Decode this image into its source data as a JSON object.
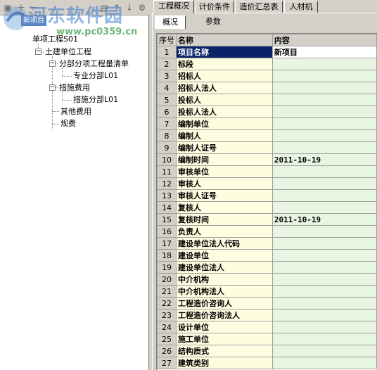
{
  "watermark": {
    "title": "河东软件园",
    "url": "www.pc0359.cn"
  },
  "tree": {
    "root": "单项工程S01",
    "root_overlay": "新项目",
    "nodes": [
      {
        "label": "土建单位工程"
      },
      {
        "label": "分部分项工程量清单"
      },
      {
        "label": "专业分部L01"
      },
      {
        "label": "措施费用"
      },
      {
        "label": "措施分部L01"
      },
      {
        "label": "其他费用"
      },
      {
        "label": "规费"
      }
    ]
  },
  "main_tabs": [
    "工程概况",
    "计价条件",
    "造价汇总表",
    "人材机"
  ],
  "sub_tabs": [
    "概况",
    "参数"
  ],
  "grid": {
    "headers": {
      "no": "序号",
      "name": "名称",
      "value": "内容"
    },
    "rows": [
      {
        "no": "1",
        "name": "项目名称",
        "value": "新项目"
      },
      {
        "no": "2",
        "name": "标段",
        "value": ""
      },
      {
        "no": "3",
        "name": "招标人",
        "value": ""
      },
      {
        "no": "4",
        "name": "招标人法人",
        "value": ""
      },
      {
        "no": "5",
        "name": "投标人",
        "value": ""
      },
      {
        "no": "6",
        "name": "投标人法人",
        "value": ""
      },
      {
        "no": "7",
        "name": "编制单位",
        "value": ""
      },
      {
        "no": "8",
        "name": "编制人",
        "value": ""
      },
      {
        "no": "9",
        "name": "编制人证号",
        "value": ""
      },
      {
        "no": "10",
        "name": "编制时间",
        "value": "2011-10-19"
      },
      {
        "no": "11",
        "name": "审核单位",
        "value": ""
      },
      {
        "no": "12",
        "name": "审核人",
        "value": ""
      },
      {
        "no": "13",
        "name": "审核人证号",
        "value": ""
      },
      {
        "no": "14",
        "name": "复核人",
        "value": ""
      },
      {
        "no": "15",
        "name": "复核时间",
        "value": "2011-10-19"
      },
      {
        "no": "16",
        "name": "负责人",
        "value": ""
      },
      {
        "no": "17",
        "name": "建设单位法人代码",
        "value": ""
      },
      {
        "no": "18",
        "name": "建设单位",
        "value": ""
      },
      {
        "no": "19",
        "name": "建设单位法人",
        "value": ""
      },
      {
        "no": "20",
        "name": "中介机构",
        "value": ""
      },
      {
        "no": "21",
        "name": "中介机构法人",
        "value": ""
      },
      {
        "no": "22",
        "name": "工程造价咨询人",
        "value": ""
      },
      {
        "no": "23",
        "name": "工程造价咨询法人",
        "value": ""
      },
      {
        "no": "24",
        "name": "设计单位",
        "value": ""
      },
      {
        "no": "25",
        "name": "施工单位",
        "value": ""
      },
      {
        "no": "26",
        "name": "结构质式",
        "value": ""
      },
      {
        "no": "27",
        "name": "建筑类别",
        "value": ""
      }
    ]
  }
}
